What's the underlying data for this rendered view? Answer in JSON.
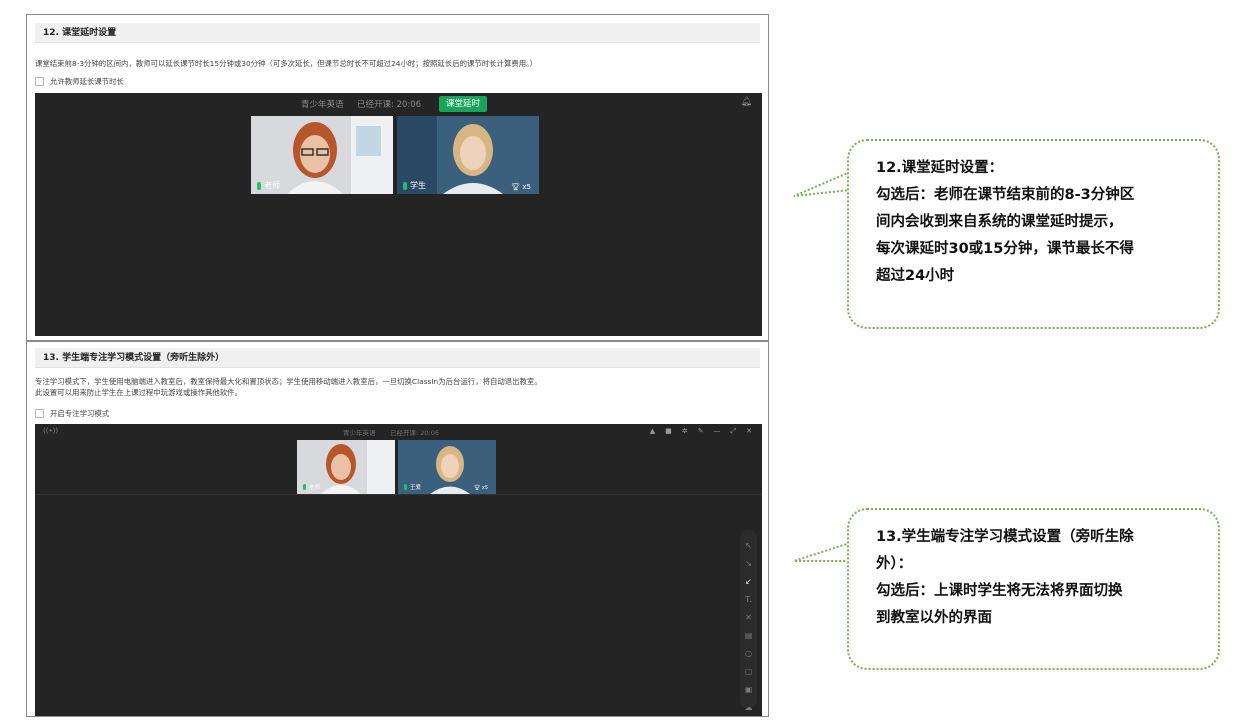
{
  "section12": {
    "heading": "12. 课堂延时设置",
    "description": "课堂结束前8-3分钟的区间内，教师可以延长课节时长15分钟或30分钟（可多次延长，但课节总时长不可超过24小时；按照延长后的课节时长计算费用。）",
    "checkbox_label": "允许教师延长课节时长",
    "classroom": {
      "course": "青少年英语",
      "elapsed": "已经开课: 20:06",
      "delay_button": "课堂延时",
      "teacher_label": "老师",
      "student_label": "学生",
      "trophy": "x5",
      "bell_icon": "bell-icon"
    }
  },
  "section13": {
    "heading": "13. 学生端专注学习模式设置（旁听生除外）",
    "description_line1": "专注学习模式下，学生使用电脑端进入教室后，教室保持最大化和置顶状态；学生使用移动端进入教室后，一旦切换ClassIn为后台运行，将自动退出教室。",
    "description_line2": "此设置可以用来防止学生在上课过程中玩游戏或操作其他软件。",
    "checkbox_label": "开启专注学习模式",
    "classroom": {
      "course": "青少年英语",
      "elapsed": "已经开课: 20:06",
      "teacher_label": "老师",
      "student_label": "王爱",
      "trophy": "x5",
      "toolbar_icons": [
        "bell-icon",
        "camera-icon",
        "gear-icon",
        "pin-icon",
        "minimize-icon",
        "expand-icon",
        "close-icon"
      ],
      "tools": [
        "cursor-icon",
        "laser-icon",
        "pen-icon",
        "text-icon",
        "eraser-icon",
        "trash-icon",
        "shape-icon",
        "board-icon",
        "toolbox-icon",
        "cloud-icon"
      ]
    }
  },
  "bubble12": {
    "line1": "12.课堂延时设置：",
    "line2": "勾选后：老师在课节结束前的8-3分钟区",
    "line3": "间内会收到来自系统的课堂延时提示，",
    "line4": "每次课延时30或15分钟，课节最长不得",
    "line5": "超过24小时"
  },
  "bubble13": {
    "line1": "13.学生端专注学习模式设置（旁听生除",
    "line2": "外）：",
    "line3": "勾选后：上课时学生将无法将界面切换",
    "line4": "到教室以外的界面"
  },
  "colors": {
    "accent_green": "#1aa35b",
    "bubble_border": "#71b34a",
    "classroom_bg": "#242424"
  }
}
